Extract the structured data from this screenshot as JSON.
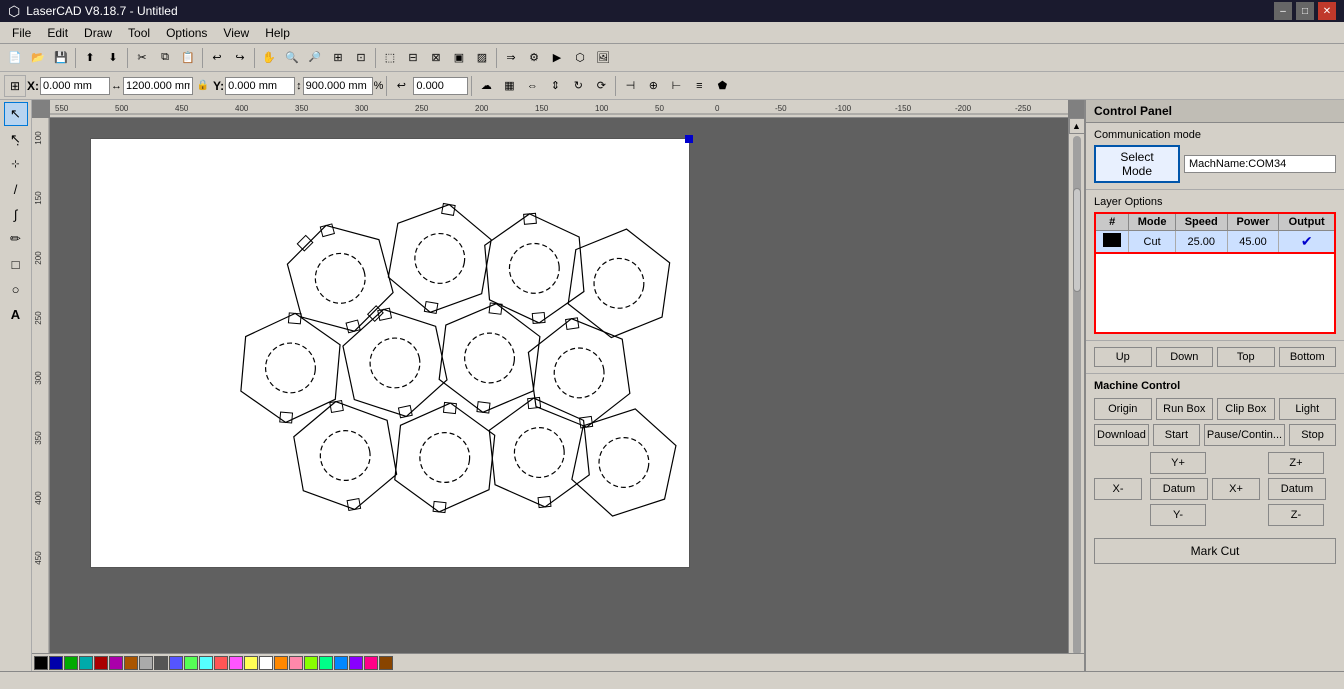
{
  "app": {
    "title": "LaserCAD V8.18.7 - Untitled",
    "icon": "laser-icon"
  },
  "titlebar": {
    "controls": {
      "minimize": "–",
      "maximize": "□",
      "close": "✕"
    }
  },
  "menubar": {
    "items": [
      "File",
      "Edit",
      "Draw",
      "Tool",
      "Options",
      "View",
      "Help"
    ]
  },
  "coordbar": {
    "x_label": "X:",
    "x_value": "0.000 mm",
    "y_label": "Y:",
    "y_value": "0.000 mm",
    "width_value": "1200.000 mm",
    "height_value": "900.000 mm",
    "angle_value": "0.000"
  },
  "controlpanel": {
    "title": "Control Panel",
    "communication": {
      "label": "Communication mode",
      "select_mode_label": "Select Mode",
      "mach_name": "MachName:COM34"
    },
    "layer_options": {
      "label": "Layer Options",
      "columns": [
        "#",
        "Mode",
        "Speed",
        "Power",
        "Output"
      ],
      "rows": [
        {
          "color": "#000000",
          "mode": "Cut",
          "speed": "25.00",
          "power": "45.00",
          "output": true
        }
      ]
    },
    "layer_buttons": {
      "up": "Up",
      "down": "Down",
      "top": "Top",
      "bottom": "Bottom"
    },
    "machine_control": {
      "label": "Machine Control",
      "buttons_row1": {
        "origin": "Origin",
        "run_box": "Run Box",
        "clip_box": "Clip Box",
        "light": "Light"
      },
      "buttons_row2": {
        "download": "Download",
        "start": "Start",
        "pause_continue": "Pause/Contin...",
        "stop": "Stop"
      },
      "jog": {
        "y_plus": "Y+",
        "z_plus": "Z+",
        "x_minus": "X-",
        "datum_left": "Datum",
        "x_plus": "X+",
        "datum_right": "Datum",
        "y_minus": "Y-",
        "z_minus": "Z-"
      },
      "mark_cut": "Mark Cut"
    }
  },
  "statusbar": {
    "text": ""
  },
  "colors": {
    "accent_blue": "#0078d7",
    "select_mode_border": "#0055aa",
    "layer_table_border": "red",
    "selected_row": "#cce0ff"
  }
}
